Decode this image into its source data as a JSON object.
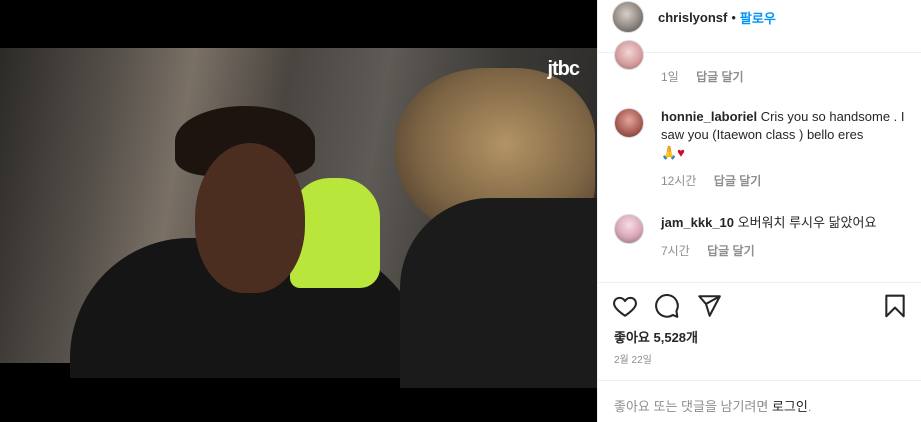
{
  "media": {
    "logo": "jtbc"
  },
  "header": {
    "username": "chrislyonsf",
    "separator": "•",
    "follow_label": "팔로우"
  },
  "comments": [
    {
      "username": "",
      "text": "",
      "time": "1일",
      "reply_label": "답글 달기"
    },
    {
      "username": "honnie_laboriel",
      "text": "Cris you so handsome . I saw you (Itaewon class ) bello eres",
      "emoji": "🙏♥",
      "time": "12시간",
      "reply_label": "답글 달기"
    },
    {
      "username": "jam_kkk_10",
      "text": "오버워치 루시우 닮았어요",
      "time": "7시간",
      "reply_label": "답글 달기"
    }
  ],
  "actions": [
    "heart-icon",
    "comment-icon",
    "share-icon",
    "bookmark-icon"
  ],
  "likes": "좋아요 5,528개",
  "date": "2월 22일",
  "login_prompt": {
    "prefix": "좋아요 또는 댓글을 남기려면 ",
    "link": "로그인",
    "suffix": "."
  },
  "colors": {
    "link_blue": "#0095f6",
    "secondary_text": "#8e8e8e"
  }
}
